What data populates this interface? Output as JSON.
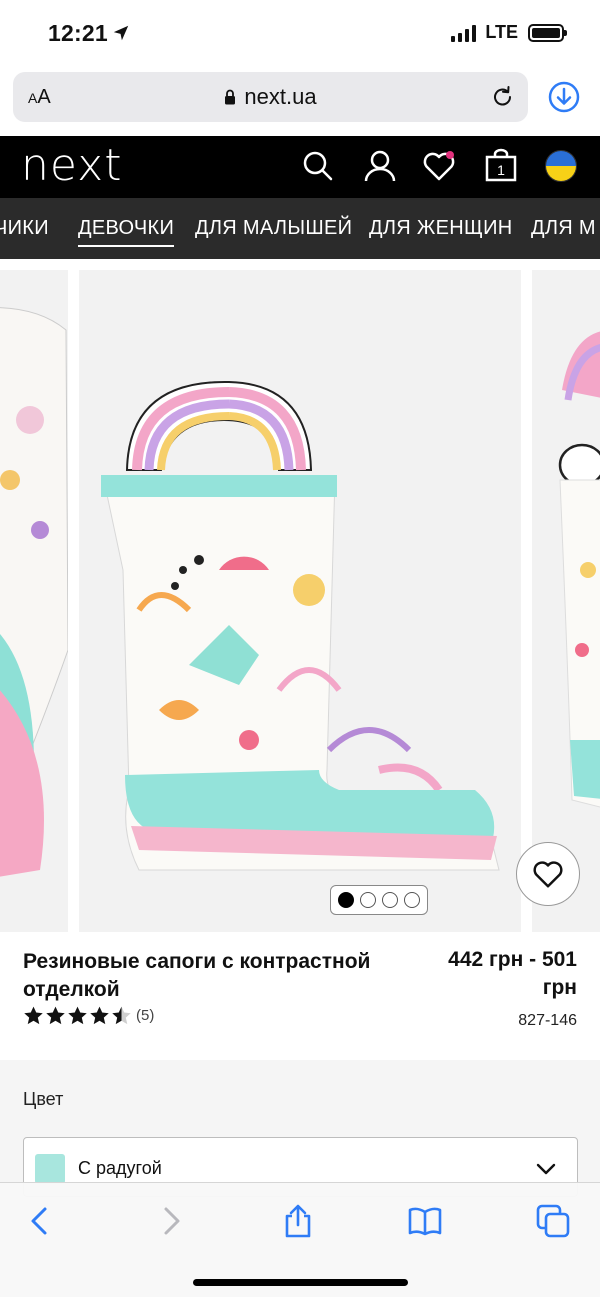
{
  "status_bar": {
    "time": "12:21",
    "network": "LTE"
  },
  "browser": {
    "text_size_label_small": "A",
    "text_size_label_large": "A",
    "url": "next.ua"
  },
  "site": {
    "logo": "next",
    "accent_color": "#000000",
    "icons": [
      "search-icon",
      "account-icon",
      "favourites-icon",
      "bag-icon",
      "ukraine-flag-icon"
    ],
    "bag_count": "1"
  },
  "categories": {
    "items": [
      {
        "label": "ЧИКИ"
      },
      {
        "label": "ДЕВОЧКИ"
      },
      {
        "label": "ДЛЯ МАЛЫШЕЙ"
      },
      {
        "label": "ДЛЯ ЖЕНЩИН"
      },
      {
        "label": "ДЛЯ М"
      }
    ],
    "active_index": 1
  },
  "carousel": {
    "slide_count": 4,
    "active_slide": 1
  },
  "product": {
    "title": "Резиновые сапоги с контрастной отделкой",
    "price_line1": "442 грн - 501",
    "price_line2": "грн",
    "rating_value": 4.5,
    "rating_count": "(5)",
    "code": "827-146"
  },
  "color_picker": {
    "label": "Цвет",
    "selected": "С радугой",
    "swatch_color": "#a8e6de"
  }
}
